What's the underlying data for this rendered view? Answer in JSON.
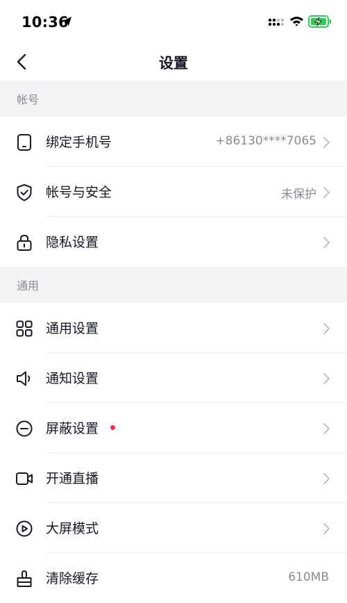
{
  "status_bar": {
    "time": "10:36",
    "icons": [
      "location-arrow-icon",
      "signal-icon",
      "wifi-icon",
      "battery-charging-icon"
    ]
  },
  "nav": {
    "title": "设置",
    "back_icon": "chevron-left-icon"
  },
  "sections": [
    {
      "header": "帐号",
      "items": [
        {
          "label": "绑定手机号",
          "value": "+86130****7065",
          "icon": "phone-icon",
          "chevron": true
        },
        {
          "label": "帐号与安全",
          "value": "未保护",
          "icon": "shield-check-icon",
          "chevron": true
        },
        {
          "label": "隐私设置",
          "value": "",
          "icon": "lock-icon",
          "chevron": true
        }
      ]
    },
    {
      "header": "通用",
      "items": [
        {
          "label": "通用设置",
          "value": "",
          "icon": "grid-icon",
          "chevron": true
        },
        {
          "label": "通知设置",
          "value": "",
          "icon": "speaker-icon",
          "chevron": true
        },
        {
          "label": "屏蔽设置",
          "value": "",
          "icon": "block-icon",
          "chevron": true,
          "badge_dot": true
        },
        {
          "label": "开通直播",
          "value": "",
          "icon": "video-camera-icon",
          "chevron": true
        },
        {
          "label": "大屏模式",
          "value": "",
          "icon": "play-screen-icon",
          "chevron": true
        },
        {
          "label": "清除缓存",
          "value": "610MB",
          "icon": "broom-icon",
          "chevron": false
        }
      ]
    }
  ],
  "colors": {
    "text_primary": "#161823",
    "text_secondary": "#8a8b91",
    "section_bg": "#f3f3f4",
    "badge_dot": "#fe2c55",
    "battery_green": "#34c759"
  }
}
